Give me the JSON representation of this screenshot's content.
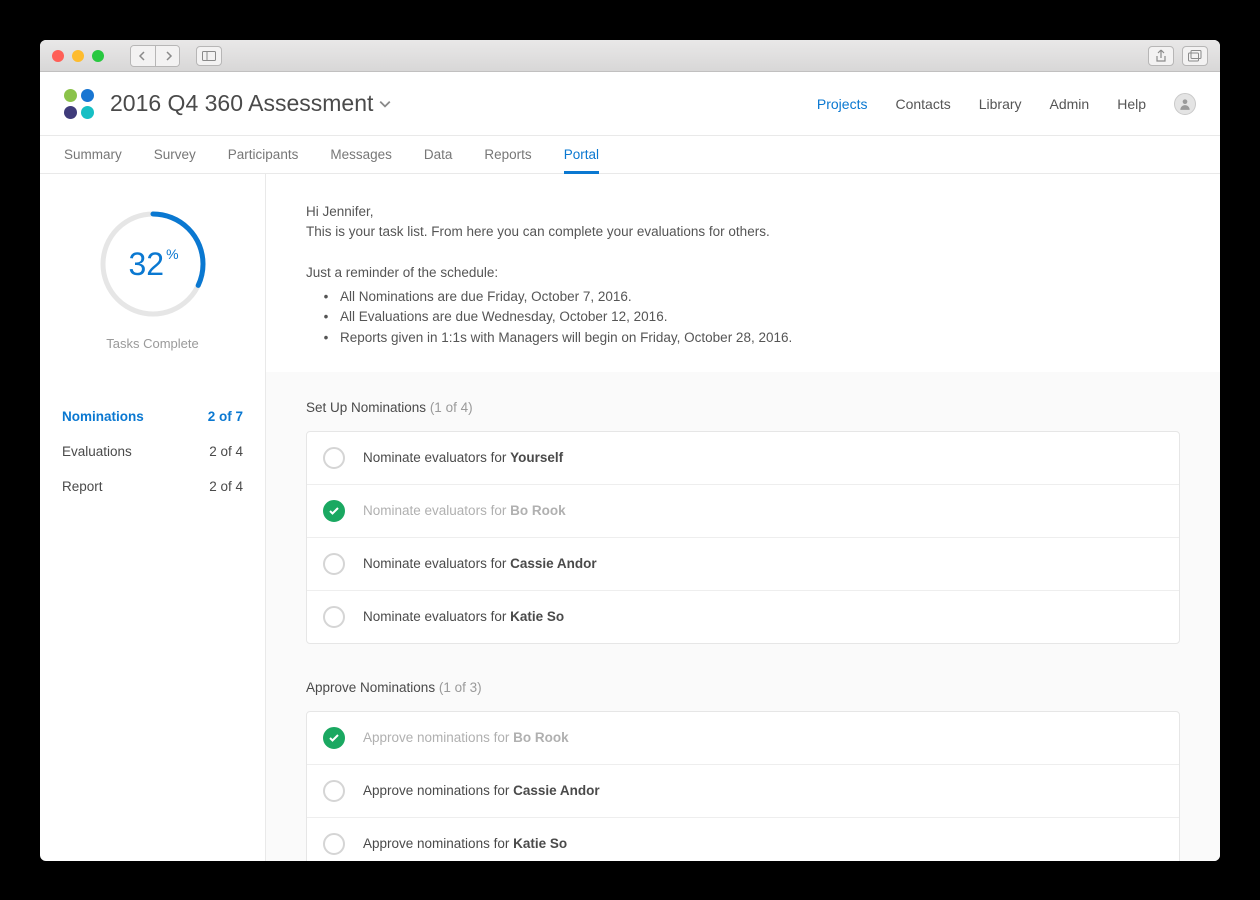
{
  "colors": {
    "accent": "#0a78d1",
    "success": "#1aa861"
  },
  "project_title": "2016 Q4 360 Assessment",
  "nav": {
    "projects": "Projects",
    "contacts": "Contacts",
    "library": "Library",
    "admin": "Admin",
    "help": "Help"
  },
  "tabs": {
    "summary": "Summary",
    "survey": "Survey",
    "participants": "Participants",
    "messages": "Messages",
    "data": "Data",
    "reports": "Reports",
    "portal": "Portal"
  },
  "gauge": {
    "percent": 32,
    "label": "Tasks Complete"
  },
  "side_items": [
    {
      "label": "Nominations",
      "count": "2 of 7",
      "active": true
    },
    {
      "label": "Evaluations",
      "count": "2 of 4",
      "active": false
    },
    {
      "label": "Report",
      "count": "2 of 4",
      "active": false
    }
  ],
  "intro": {
    "greeting": "Hi Jennifer,",
    "line1": "This is your task list. From here you can complete your evaluations for others.",
    "reminder_lead": "Just a reminder of the schedule:",
    "bullets": [
      "All Nominations are due Friday, October 7, 2016.",
      "All Evaluations are due Wednesday, October 12, 2016.",
      "Reports given in 1:1s with Managers will begin on Friday, October 28, 2016."
    ]
  },
  "sections": [
    {
      "title": "Set Up Nominations",
      "count": "(1 of 4)",
      "action_prefix": "Nominate evaluators for ",
      "tasks": [
        {
          "subject": "Yourself",
          "done": false
        },
        {
          "subject": "Bo Rook",
          "done": true
        },
        {
          "subject": "Cassie Andor",
          "done": false
        },
        {
          "subject": "Katie So",
          "done": false
        }
      ]
    },
    {
      "title": "Approve Nominations",
      "count": "(1 of 3)",
      "action_prefix": "Approve nominations for ",
      "tasks": [
        {
          "subject": "Bo Rook",
          "done": true
        },
        {
          "subject": "Cassie Andor",
          "done": false
        },
        {
          "subject": "Katie So",
          "done": false
        }
      ]
    }
  ]
}
